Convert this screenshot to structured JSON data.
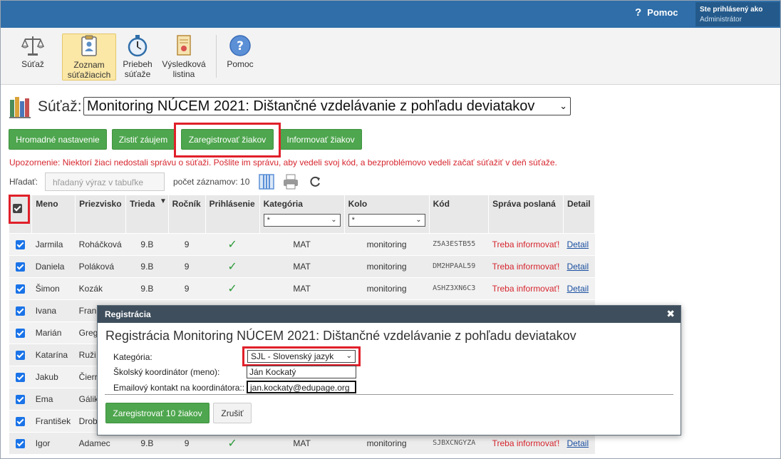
{
  "header": {
    "help_label": "Pomoc",
    "user_line1": "Ste prihlásený ako",
    "user_line2": "Administrátor"
  },
  "toolbar": {
    "items": [
      {
        "label1": "Súťaž",
        "label2": ""
      },
      {
        "label1": "Zoznam",
        "label2": "súťažiacich"
      },
      {
        "label1": "Priebeh",
        "label2": "súťaže"
      },
      {
        "label1": "Výsledková",
        "label2": "listina"
      },
      {
        "label1": "Pomoc",
        "label2": ""
      }
    ]
  },
  "competition": {
    "label": "Súťaž:",
    "selected": "Monitoring NÚCEM 2021: Dištančné vzdelávanie z pohľadu deviatakov"
  },
  "actions": {
    "bulk": "Hromadné nastavenie",
    "interest": "Zistiť záujem",
    "register": "Zaregistrovať žiakov",
    "inform": "Informovať žiakov"
  },
  "warning": "Upozornenie: Niektorí žiaci nedostali správu o súťaži. Pošlite im správu, aby vedeli svoj kód, a bezproblémovo vedeli začať súťažiť v deň súťaže.",
  "search": {
    "label": "Hľadať:",
    "placeholder": "hľadaný výraz v tabuľke",
    "count_text": "počet záznamov: 10"
  },
  "table": {
    "headers": [
      "Meno",
      "Priezvisko",
      "Trieda",
      "Ročník",
      "Prihlásenie",
      "Kategória",
      "Kolo",
      "Kód",
      "Správa poslaná",
      "Detail"
    ],
    "filter_all": "*",
    "rows": [
      {
        "meno": "Jarmila",
        "priezvisko": "Roháčková",
        "trieda": "9.B",
        "rocnik": "9",
        "kategoria": "MAT",
        "kolo": "monitoring",
        "kod": "Z5A3ESTB55",
        "sprava": "Treba informovať!",
        "detail": "Detail"
      },
      {
        "meno": "Daniela",
        "priezvisko": "Poláková",
        "trieda": "9.B",
        "rocnik": "9",
        "kategoria": "MAT",
        "kolo": "monitoring",
        "kod": "DM2HPAAL59",
        "sprava": "Treba informovať!",
        "detail": "Detail"
      },
      {
        "meno": "Šimon",
        "priezvisko": "Kozák",
        "trieda": "9.B",
        "rocnik": "9",
        "kategoria": "MAT",
        "kolo": "monitoring",
        "kod": "ASHZ3XN6C3",
        "sprava": "Treba informovať!",
        "detail": "Detail"
      },
      {
        "meno": "Ivana",
        "priezvisko": "Fran"
      },
      {
        "meno": "Marián",
        "priezvisko": "Greg"
      },
      {
        "meno": "Katarína",
        "priezvisko": "Ruži"
      },
      {
        "meno": "Jakub",
        "priezvisko": "Čierr"
      },
      {
        "meno": "Ema",
        "priezvisko": "Gálik"
      },
      {
        "meno": "František",
        "priezvisko": "Drob"
      },
      {
        "meno": "Igor",
        "priezvisko": "Adamec",
        "trieda": "9.B",
        "rocnik": "9",
        "kategoria": "MAT",
        "kolo": "monitoring",
        "kod": "SJBXCNGYZA",
        "sprava": "Treba informovať!",
        "detail": "Detail"
      }
    ]
  },
  "modal": {
    "header": "Registrácia",
    "title": "Registrácia Monitoring NÚCEM 2021: Dištančné vzdelávanie z pohľadu deviatakov",
    "category_label": "Kategória:",
    "category_value": "SJL - Slovenský jazyk",
    "coordinator_label": "Školský koordinátor (meno):",
    "coordinator_value": "Ján Kockatý",
    "email_label": "Emailový kontakt na koordinátora::",
    "email_value": "jan.kockaty@edupage.org",
    "register_button": "Zaregistrovať 10 žiakov",
    "cancel_button": "Zrušiť"
  },
  "colors": {
    "topbar": "#2f6ea9",
    "green": "#4ea64e",
    "highlight_red": "#e0202a",
    "warning_red": "#d6262e"
  }
}
